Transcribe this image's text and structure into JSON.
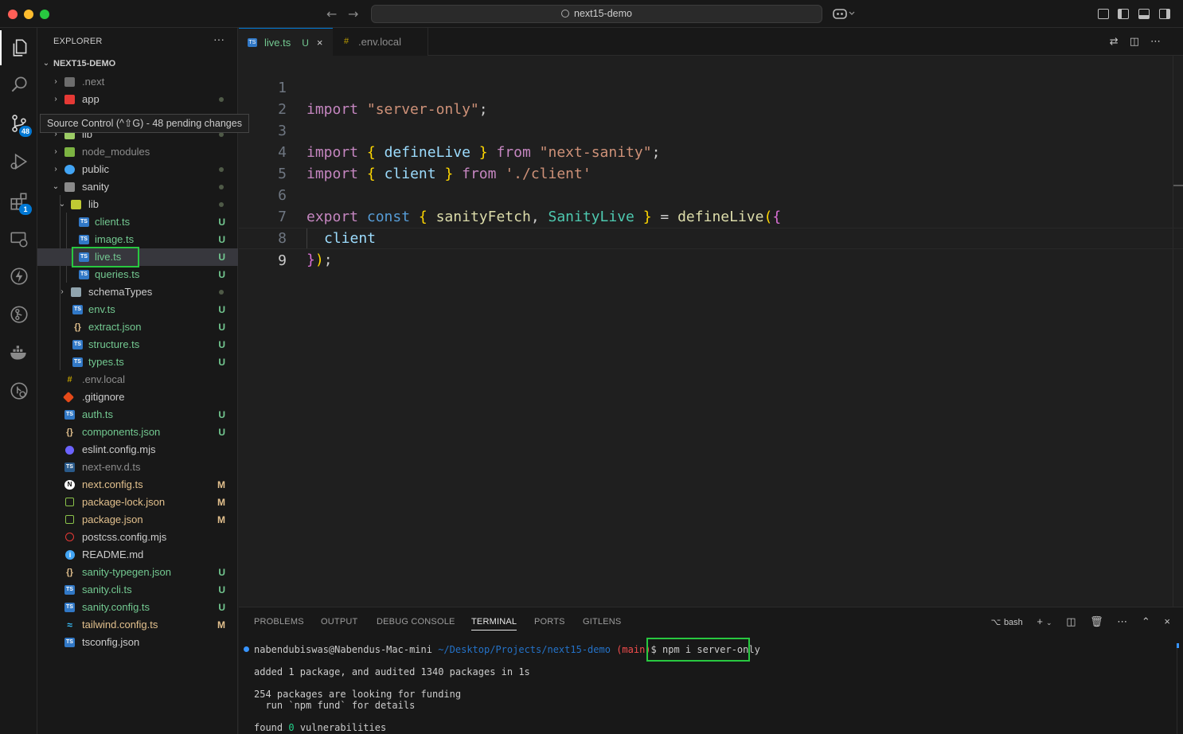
{
  "window": {
    "search_text": "next15-demo"
  },
  "activity": {
    "scm_badge": "48",
    "extensions_badge": "1"
  },
  "tooltip": {
    "text": "Source Control (^⇧G) - 48 pending changes"
  },
  "explorer": {
    "title": "EXPLORER",
    "more": "···",
    "project": "NEXT15-DEMO",
    "items": [
      {
        "name": ".next",
        "status": "",
        "icon": "folder-next-icon",
        "color": "#8c8c8c"
      },
      {
        "name": "app",
        "status": "dot",
        "icon": "folder-app-icon",
        "color": "#cccccc"
      },
      {
        "name": "lib",
        "status": "dot",
        "icon": "folder-lib-icon",
        "color": "#cccccc"
      },
      {
        "name": "node_modules",
        "status": "",
        "icon": "folder-node-icon",
        "color": "#8c8c8c"
      },
      {
        "name": "public",
        "status": "dot",
        "icon": "folder-public-icon",
        "color": "#cccccc"
      },
      {
        "name": "sanity",
        "status": "dot",
        "icon": "folder-sanity-icon",
        "color": "#cccccc"
      },
      {
        "name": "lib",
        "status": "dot",
        "icon": "folder-open-icon",
        "color": "#cccccc"
      },
      {
        "name": "client.ts",
        "status": "U",
        "icon": "ts-file-icon",
        "color": "#73c991"
      },
      {
        "name": "image.ts",
        "status": "U",
        "icon": "ts-file-icon",
        "color": "#73c991"
      },
      {
        "name": "live.ts",
        "status": "U",
        "icon": "ts-file-icon",
        "color": "#73c991"
      },
      {
        "name": "queries.ts",
        "status": "U",
        "icon": "ts-file-icon",
        "color": "#73c991"
      },
      {
        "name": "schemaTypes",
        "status": "dot",
        "icon": "folder-icon",
        "color": "#cccccc"
      },
      {
        "name": "env.ts",
        "status": "U",
        "icon": "ts-file-icon",
        "color": "#73c991"
      },
      {
        "name": "extract.json",
        "status": "U",
        "icon": "json-file-icon",
        "color": "#73c991"
      },
      {
        "name": "structure.ts",
        "status": "U",
        "icon": "ts-file-icon",
        "color": "#73c991"
      },
      {
        "name": "types.ts",
        "status": "U",
        "icon": "ts-file-icon",
        "color": "#73c991"
      },
      {
        "name": ".env.local",
        "status": "",
        "icon": "env-file-icon",
        "color": "#8c8c8c"
      },
      {
        "name": ".gitignore",
        "status": "",
        "icon": "git-file-icon",
        "color": "#cccccc"
      },
      {
        "name": "auth.ts",
        "status": "U",
        "icon": "ts-file-icon",
        "color": "#73c991"
      },
      {
        "name": "components.json",
        "status": "U",
        "icon": "json-file-icon",
        "color": "#73c991"
      },
      {
        "name": "eslint.config.mjs",
        "status": "",
        "icon": "eslint-file-icon",
        "color": "#cccccc"
      },
      {
        "name": "next-env.d.ts",
        "status": "",
        "icon": "ts-file-icon",
        "color": "#8c8c8c"
      },
      {
        "name": "next.config.ts",
        "status": "M",
        "icon": "next-file-icon",
        "color": "#e2c08d"
      },
      {
        "name": "package-lock.json",
        "status": "M",
        "icon": "npm-file-icon",
        "color": "#e2c08d"
      },
      {
        "name": "package.json",
        "status": "M",
        "icon": "npm-file-icon",
        "color": "#e2c08d"
      },
      {
        "name": "postcss.config.mjs",
        "status": "",
        "icon": "postcss-file-icon",
        "color": "#cccccc"
      },
      {
        "name": "README.md",
        "status": "",
        "icon": "info-file-icon",
        "color": "#cccccc"
      },
      {
        "name": "sanity-typegen.json",
        "status": "U",
        "icon": "json-file-icon",
        "color": "#73c991"
      },
      {
        "name": "sanity.cli.ts",
        "status": "U",
        "icon": "ts-file-icon",
        "color": "#73c991"
      },
      {
        "name": "sanity.config.ts",
        "status": "U",
        "icon": "ts-file-icon",
        "color": "#73c991"
      },
      {
        "name": "tailwind.config.ts",
        "status": "M",
        "icon": "tailwind-file-icon",
        "color": "#e2c08d"
      },
      {
        "name": "tsconfig.json",
        "status": "",
        "icon": "tsconfig-file-icon",
        "color": "#cccccc"
      }
    ]
  },
  "tabs": [
    {
      "label": "live.ts",
      "status": "U",
      "close": "×"
    },
    {
      "label": ".env.local"
    }
  ],
  "editor": {
    "line_numbers": [
      "1",
      "2",
      "3",
      "4",
      "5",
      "6",
      "7",
      "8",
      "9"
    ],
    "line1": {
      "kw": "import",
      "str": "\"server-only\"",
      "semi": ";"
    },
    "line3": {
      "kw": "import",
      "ob": "{",
      "name": "defineLive",
      "cb": "}",
      "from": "from",
      "str": "\"next-sanity\"",
      "semi": ";"
    },
    "line4": {
      "kw": "import",
      "ob": "{",
      "name": "client",
      "cb": "}",
      "from": "from",
      "str": "'./client'"
    },
    "line6": {
      "kw1": "export",
      "kw2": "const",
      "ob": "{",
      "v1": "sanityFetch",
      "comma": ",",
      "v2": "SanityLive",
      "cb": "}",
      "eq": "=",
      "fn": "defineLive",
      "p1": "(",
      "b2": "{"
    },
    "line7": {
      "prop": "client"
    },
    "line8": {
      "b2": "}",
      "p1": ")",
      "semi": ";"
    }
  },
  "panel": {
    "tabs": [
      "PROBLEMS",
      "OUTPUT",
      "DEBUG CONSOLE",
      "TERMINAL",
      "PORTS",
      "GITLENS"
    ],
    "shell": "bash",
    "prompt_user": "nabendubiswas@Nabendus-Mac-mini",
    "prompt_path": "~/Desktop/Projects/next15-demo",
    "prompt_branch": "(main)",
    "prompt_symbol": "$",
    "command": "npm i server-only",
    "output": [
      "added 1 package, and audited 1340 packages in 1s",
      "254 packages are looking for funding",
      "  run `npm fund` for details",
      "found"
    ],
    "vuln_count": "0",
    "vuln_text": "vulnerabilities"
  }
}
